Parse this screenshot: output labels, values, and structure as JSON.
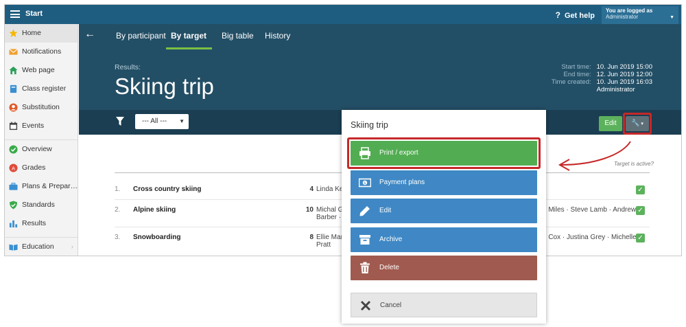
{
  "topbar": {
    "app_title": "Start",
    "help_icon": "?",
    "help_label": "Get help",
    "login_line1": "You are logged as",
    "login_line2": "Administrator"
  },
  "sidebar": {
    "items": [
      {
        "label": "Home",
        "icon": "star-icon",
        "color": "#f5b800"
      },
      {
        "label": "Notifications",
        "icon": "envelope-icon",
        "color": "#f0a030"
      },
      {
        "label": "Web page",
        "icon": "house-icon",
        "color": "#2ca05a"
      },
      {
        "label": "Class register",
        "icon": "book-icon",
        "color": "#3a8fd0"
      },
      {
        "label": "Substitution",
        "icon": "person-icon",
        "color": "#e05a2a"
      },
      {
        "label": "Events",
        "icon": "calendar-icon",
        "color": "#444444"
      },
      {
        "label": "Overview",
        "icon": "check-circle-icon",
        "color": "#3aaa4a"
      },
      {
        "label": "Grades",
        "icon": "grades-icon",
        "color": "#e04a3a"
      },
      {
        "label": "Plans & Prepar…",
        "icon": "briefcase-icon",
        "color": "#3a8fd0"
      },
      {
        "label": "Standards",
        "icon": "shield-icon",
        "color": "#3aaa4a"
      },
      {
        "label": "Results",
        "icon": "bar-chart-icon",
        "color": "#3a8fd0"
      },
      {
        "label": "Education",
        "icon": "open-book-icon",
        "color": "#3a8fd0"
      }
    ]
  },
  "header": {
    "tabs": [
      "By participant",
      "By target",
      "Big table",
      "History"
    ],
    "active_tab": "By target",
    "results_label": "Results:",
    "title": "Skiing trip",
    "meta": [
      {
        "key": "Start time:",
        "value": "10. Jun 2019 15:00"
      },
      {
        "key": "End time:",
        "value": "12. Jun 2019 12:00"
      },
      {
        "key": "Time created:",
        "value": "10. Jun 2019 16:03"
      },
      {
        "key": "",
        "value": "Administrator"
      }
    ]
  },
  "filterbar": {
    "select_value": "--- All ---",
    "edit_label": "Edit"
  },
  "table": {
    "active_header": "Target is active?",
    "rows": [
      {
        "num": "1.",
        "name": "Cross country skiing",
        "count": "4",
        "people": "Linda Kels",
        "people_right": ""
      },
      {
        "num": "2.",
        "name": "Alpine skiing",
        "count": "10",
        "people": "Michal Gr Barber · D",
        "people_right": "n Miles · Steve Lamb · Andrew"
      },
      {
        "num": "3.",
        "name": "Snowboarding",
        "count": "8",
        "people": "Ellie Mars Pratt",
        "people_right": "n Cox · Justina Grey · Michelle"
      }
    ]
  },
  "modal": {
    "title": "Skiing trip",
    "buttons": [
      {
        "label": "Print / export",
        "icon": "printer-icon",
        "style": "green"
      },
      {
        "label": "Payment plans",
        "icon": "money-icon",
        "style": "blue"
      },
      {
        "label": "Edit",
        "icon": "pencil-icon",
        "style": "blue"
      },
      {
        "label": "Archive",
        "icon": "archive-box-icon",
        "style": "blue"
      },
      {
        "label": "Delete",
        "icon": "trash-icon",
        "style": "red"
      },
      {
        "label": "Cancel",
        "icon": "close-icon",
        "style": "gray"
      }
    ]
  },
  "colors": {
    "topbar": "#1f5d80",
    "header": "#234f66",
    "filterbar": "#1b3e52",
    "green": "#52ad52",
    "blue": "#3f88c5",
    "red": "#a05a4f",
    "highlight": "#c62828"
  }
}
